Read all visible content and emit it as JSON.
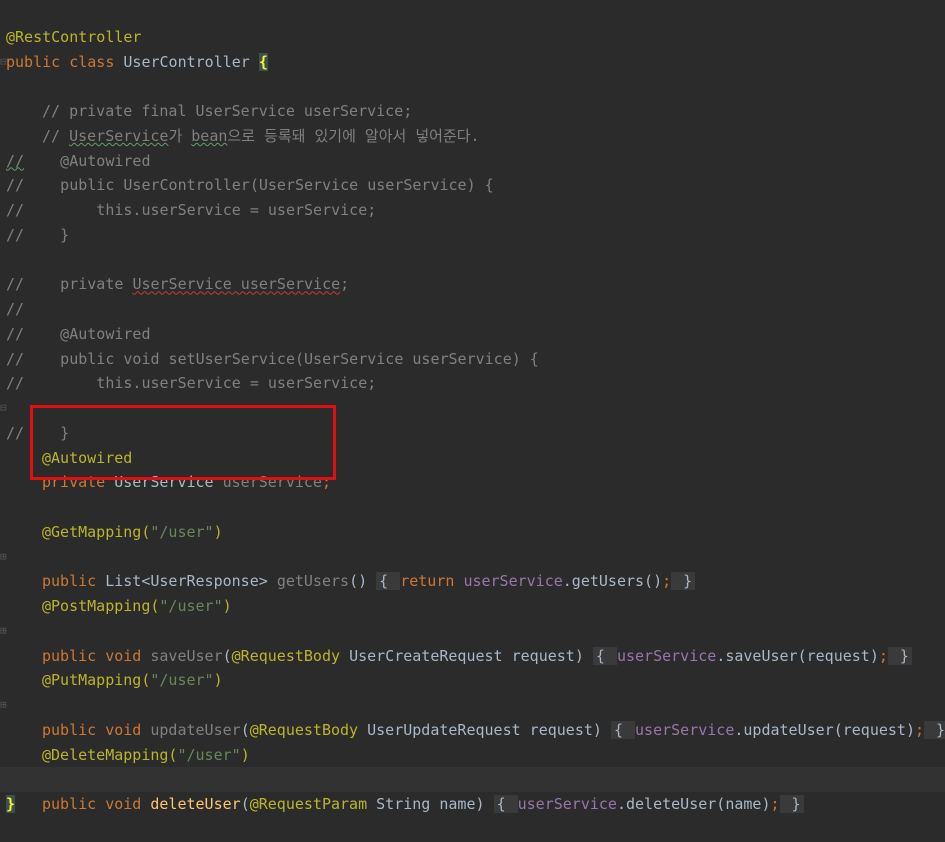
{
  "code": {
    "l1": {
      "ann": "@RestController"
    },
    "l2": {
      "kw": "public class ",
      "name": "UserController ",
      "brace": "{"
    },
    "l3": {
      "cmt": "// private final UserService userService;"
    },
    "l5": {
      "cmt_a": "// ",
      "typo1": "UserService",
      "ko1": "가 ",
      "typo2": "bean",
      "ko2": "으로 등록돼 있기에 알아서 넣어준다."
    },
    "l6": {
      "gut": "//",
      "text": "    @Autowired"
    },
    "l7": {
      "gut": "//",
      "text": "    public UserController(UserService userService) {"
    },
    "l8": {
      "gut": "//",
      "text": "        this.userService = userService;"
    },
    "l9": {
      "gut": "//",
      "text": "    }"
    },
    "l11": {
      "gut": "//",
      "text": "    private ",
      "err": "UserService userService",
      "tail": ";"
    },
    "l12": {
      "gut": "//"
    },
    "l13": {
      "gut": "//",
      "text": "    @Autowired"
    },
    "l14": {
      "gut": "//",
      "text": "    public void setUserService(UserService userService) {"
    },
    "l15": {
      "gut": "//",
      "text": "        this.userService = userService;"
    },
    "l16": {
      "gut": "//",
      "text": "    }"
    },
    "l18": {
      "ann": "@Autowired"
    },
    "l19": {
      "kw": "private ",
      "type": "UserService ",
      "var": "userService",
      "semi": ";"
    },
    "l21": {
      "ann": "@GetMapping(",
      "str": "\"/user\"",
      "close": ")"
    },
    "l22": {
      "kw": "public ",
      "type": "List<UserResponse> ",
      "fn": "getUsers",
      "paren": "() ",
      "fold1": "{ ",
      "kw2": "return ",
      "field": "userService",
      "call": ".getUsers()",
      "semi": ";",
      "fold2": " }"
    },
    "l24": {
      "ann": "@PostMapping(",
      "str": "\"/user\"",
      "close": ")"
    },
    "l25": {
      "kw": "public void ",
      "fn": "saveUser",
      "open": "(",
      "ann": "@RequestBody ",
      "params": "UserCreateRequest request) ",
      "fold1": "{ ",
      "field": "userService",
      "call": ".saveUser(request)",
      "semi": ";",
      "fold2": " }"
    },
    "l27": {
      "ann": "@PutMapping(",
      "str": "\"/user\"",
      "close": ")"
    },
    "l28": {
      "kw": "public void ",
      "fn": "updateUser",
      "open": "(",
      "ann": "@RequestBody ",
      "params": "UserUpdateRequest request) ",
      "fold1": "{ ",
      "field": "userService",
      "call": ".updateUser(request)",
      "semi": ";",
      "fold2": " }"
    },
    "l30": {
      "ann": "@DeleteMapping(",
      "str": "\"/user\"",
      "close": ")"
    },
    "l31": {
      "kw": "public void ",
      "fn": "deleteUser",
      "open": "(",
      "ann": "@RequestParam ",
      "params": "String name) ",
      "fold1": "{ ",
      "field": "userService",
      "call": ".deleteUser(name)",
      "semi": ";",
      "fold2": " }"
    },
    "l32": {
      "brace": "}"
    }
  },
  "colors": {
    "background": "#2b2b2b",
    "annotation": "#bbb529",
    "keyword": "#cc7832",
    "comment": "#808080",
    "string": "#6a8759",
    "field": "#9876aa",
    "highlight_box": "#e01010"
  }
}
